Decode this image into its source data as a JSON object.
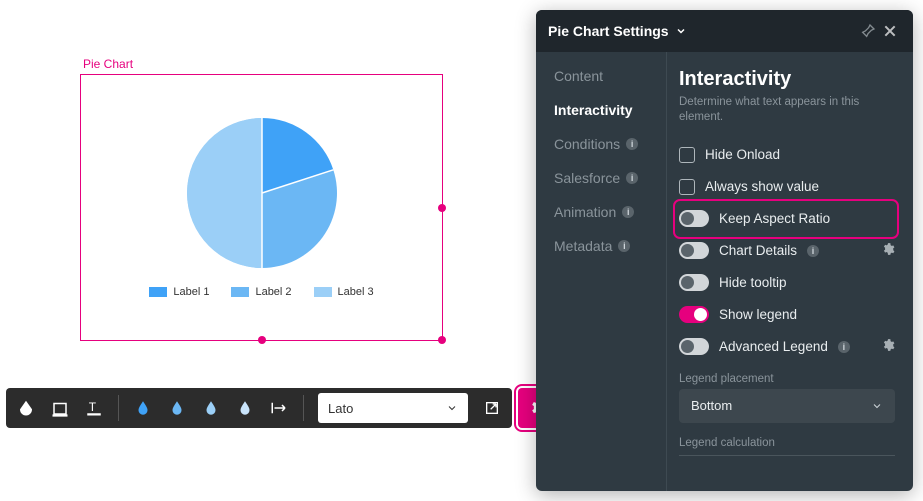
{
  "canvas": {
    "title": "Pie Chart",
    "legend": [
      "Label 1",
      "Label 2",
      "Label 3"
    ]
  },
  "chart_data": {
    "type": "pie",
    "title": "Pie Chart",
    "series": [
      {
        "name": "Label 1",
        "value": 17,
        "color": "#3FA2F7"
      },
      {
        "name": "Label 2",
        "value": 33,
        "color": "#6BB7F4"
      },
      {
        "name": "Label 3",
        "value": 50,
        "color": "#9BCFF7"
      }
    ],
    "legend_position": "bottom"
  },
  "toolbar": {
    "font": "Lato"
  },
  "panel": {
    "title": "Pie Chart Settings",
    "tabs": {
      "content": "Content",
      "interactivity": "Interactivity",
      "conditions": "Conditions",
      "salesforce": "Salesforce",
      "animation": "Animation",
      "metadata": "Metadata"
    },
    "section": {
      "heading": "Interactivity",
      "sub": "Determine what text appears in this element."
    },
    "options": {
      "hide_onload": "Hide Onload",
      "always_show_value": "Always show value",
      "keep_aspect": "Keep Aspect Ratio",
      "chart_details": "Chart Details",
      "hide_tooltip": "Hide tooltip",
      "show_legend": "Show legend",
      "advanced_legend": "Advanced Legend"
    },
    "legend_placement": {
      "label": "Legend placement",
      "value": "Bottom"
    },
    "legend_calc_label": "Legend calculation"
  }
}
